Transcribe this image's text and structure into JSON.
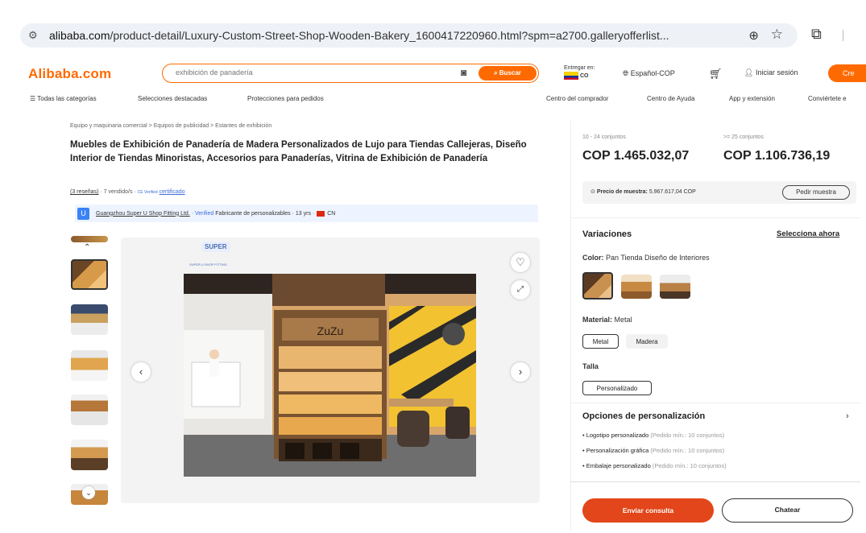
{
  "browser": {
    "url_domain": "alibaba.com",
    "url_path": "/product-detail/Luxury-Custom-Street-Shop-Wooden-Bakery_1600417220960.html?spm=a2700.galleryofferlist..."
  },
  "header": {
    "logo": "Alibaba.com",
    "search_placeholder": "exhibición de panadería",
    "search_button": "Buscar",
    "deliver_label": "Entregar en:",
    "deliver_country": "CO",
    "language": "Español-COP",
    "login": "Iniciar sesión",
    "create": "Cre"
  },
  "nav": {
    "left": [
      "Todas las categorías",
      "Selecciones destacadas",
      "Protecciones para pedidos"
    ],
    "right": [
      "Centro del comprador",
      "Centro de Ayuda",
      "App y extensión",
      "Conviértete e"
    ]
  },
  "product": {
    "breadcrumb": "Equipo y maquinaria comercial  >  Equipos de publicidad  >  Estantes de exhibición",
    "title": "Muebles de Exhibición de Panadería de Madera Personalizados de Lujo para Tiendas Callejeras, Diseño Interior de Tiendas Minoristas, Accesorios para Panaderías, Vitrina de Exhibición de Panadería",
    "reviews": "(3 reseñas)",
    "sold": "· 7 vendido/s ·",
    "verified_tag": "CE Verified",
    "cert": "certificado",
    "supplier_initial": "U",
    "supplier_name": "Guangzhou Super U Shop Fitting Ltd.",
    "supplier_verified": "· Verified",
    "supplier_desc": "Fabricante de personalizables · 13 yrs ·",
    "supplier_country": "CN",
    "image_brand": "SUPER",
    "image_brand_sub": "SUPER U SHOP FITTING",
    "sign_text": "ZuZu"
  },
  "pricing": {
    "tier1_label": "10 - 24 conjuntos",
    "tier1_price": "COP 1.465.032,07",
    "tier2_label": ">= 25 conjuntos",
    "tier2_price": "COP 1.106.736,19",
    "sample_label": "Precio de muestra:",
    "sample_price": "5.967.617,04 COP",
    "sample_button": "Pedir muestra"
  },
  "variations": {
    "heading": "Variaciones",
    "select_link": "Selecciona ahora",
    "color_label": "Color:",
    "color_value": "Pan Tienda Diseño de Interiores",
    "material_label": "Material:",
    "material_value": "Metal",
    "materials": [
      "Metal",
      "Madera"
    ],
    "size_label": "Talla",
    "size_value": "Personalizado"
  },
  "customization": {
    "heading": "Opciones de personalización",
    "options": [
      {
        "name": "Logotipo personalizado",
        "note": "(Pedido mín.: 10 conjuntos)"
      },
      {
        "name": "Personalización gráfica",
        "note": "(Pedido mín.: 10 conjuntos)"
      },
      {
        "name": "Embalaje personalizado",
        "note": "(Pedido mín.: 10 conjuntos)"
      }
    ]
  },
  "actions": {
    "inquiry": "Enviar consulta",
    "chat": "Chatear"
  },
  "colors": {
    "brand": "#ff6a00",
    "inquiry_button": "#e2461a"
  }
}
